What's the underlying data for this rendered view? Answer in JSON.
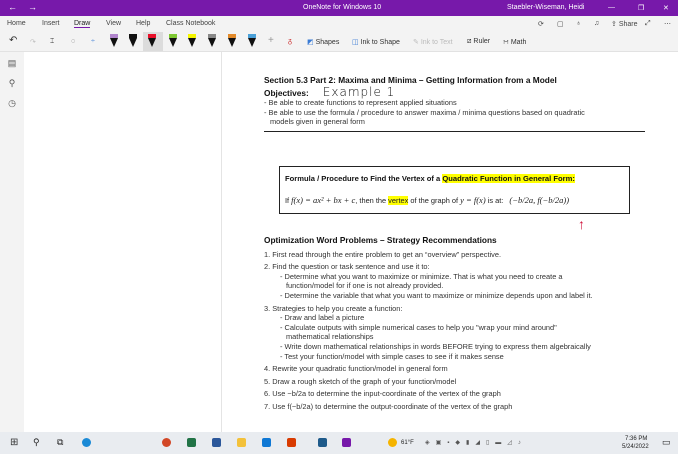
{
  "window": {
    "title": "OneNote for Windows 10",
    "user": "Staebler-Wiseman, Heidi",
    "accent": "#7719aa"
  },
  "tabs": [
    {
      "label": "Home"
    },
    {
      "label": "Insert"
    },
    {
      "label": "Draw",
      "active": true
    },
    {
      "label": "View"
    },
    {
      "label": "Help"
    },
    {
      "label": "Class Notebook"
    }
  ],
  "ribbon_right": {
    "share": "Share"
  },
  "toolbar": {
    "shapes": "Shapes",
    "ink_to_shape": "Ink to Shape",
    "ink_to_text": "Ink to Text",
    "ruler": "Ruler",
    "math": "Math"
  },
  "pens": [
    {
      "color": "#b084cc"
    },
    {
      "color": "#111111"
    },
    {
      "color": "#e8102a",
      "selected": true
    },
    {
      "color": "#7ec832"
    },
    {
      "color": "#f5f500"
    },
    {
      "color": "#888888"
    },
    {
      "color": "#e28a2a"
    },
    {
      "color": "#4aa0d8"
    }
  ],
  "page": {
    "title": "Section 5.3 Part 2:  Maxima and Minima – Getting Information from a Model",
    "objectives_label": "Objectives:",
    "handwriting": "Example 1",
    "objectives": [
      "- Be able to create functions to represent applied situations",
      "- Be able to use the formula / procedure to answer maxima / minima questions based on quadratic",
      "models given in general form"
    ],
    "box_title_pre": "Formula / Procedure to Find the Vertex of a ",
    "box_title_hl": "Quadratic Function in General Form:",
    "box_line_1": "If ",
    "box_fx": "f(x) = ax² + bx + c",
    "box_line_2": ", then the ",
    "box_vertex": "vertex",
    "box_line_3": " of the graph of ",
    "box_y": "y = f(x)",
    "box_line_4": " is at:",
    "box_formula": "(−b/2a, f(−b/2a))",
    "section2_title": "Optimization Word Problems – Strategy Recommendations",
    "steps": [
      {
        "text": "1.  First read through the entire problem to get an “overview” perspective."
      },
      {
        "text": "2.  Find the question or task sentence and use it to:",
        "sub": [
          "- Determine what you want to maximize or minimize. That is what you need to create a",
          "  function/model for if one is not already provided.",
          "- Determine the variable that what you want to maximize or minimize depends upon and label it."
        ]
      },
      {
        "text": "3.  Strategies to help you create a function:",
        "sub": [
          "- Draw and label a picture",
          "- Calculate outputs with simple numerical cases to help you \"wrap your mind around\"",
          "  mathematical relationships",
          "- Write down mathematical relationships in words BEFORE trying to express them algebraically",
          "- Test your function/model with simple cases to see if it makes sense"
        ]
      },
      {
        "text": "4.  Rewrite your quadratic function/model in general form"
      },
      {
        "text": "5.  Draw a rough sketch of the graph of your function/model"
      },
      {
        "text": "6.  Use −b/2a to determine the input-coordinate of the vertex of the graph"
      },
      {
        "text": "7.  Use f(−b/2a) to determine the output-coordinate of the vertex of the graph"
      }
    ]
  },
  "taskbar": {
    "weather": "61°F",
    "time": "7:36 PM",
    "date": "5/24/2022"
  }
}
